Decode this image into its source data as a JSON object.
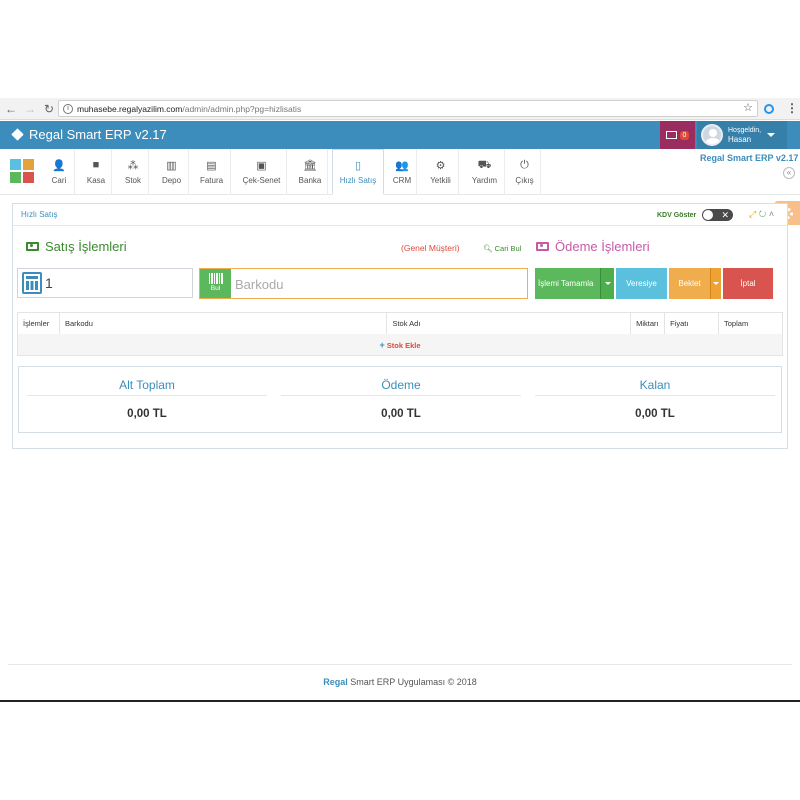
{
  "browser": {
    "url_host": "muhasebe.regalyazilim.com",
    "url_path": "/admin/admin.php?pg=hizlisatis"
  },
  "header": {
    "app_title": "Regal Smart ERP v2.17",
    "notification_count": "0",
    "greeting": "Hoşgeldin,",
    "user_name": "Hasan",
    "colors": {
      "primary": "#3c8dbc",
      "notification_bg": "#9b2c5f"
    }
  },
  "toolbar": {
    "items": [
      {
        "label": "Cari",
        "icon": "user-plus-icon"
      },
      {
        "label": "Kasa",
        "icon": "briefcase-icon"
      },
      {
        "label": "Stok",
        "icon": "cubes-icon"
      },
      {
        "label": "Depo",
        "icon": "building-icon"
      },
      {
        "label": "Fatura",
        "icon": "file-icon"
      },
      {
        "label": "Çek-Senet",
        "icon": "money-icon"
      },
      {
        "label": "Banka",
        "icon": "bank-icon"
      },
      {
        "label": "Hızlı Satış",
        "icon": "mobile-icon",
        "active": true
      },
      {
        "label": "CRM",
        "icon": "users-icon"
      },
      {
        "label": "Yetkili",
        "icon": "cogs-icon"
      },
      {
        "label": "Yardım",
        "icon": "truck-icon"
      },
      {
        "label": "Çıkış",
        "icon": "power-icon"
      }
    ],
    "brand_right": "Regal Smart ERP v2.17"
  },
  "panel": {
    "title": "Hızlı Satış",
    "kdv_label": "KDV Göster"
  },
  "sale": {
    "title": "Satış İşlemleri",
    "customer": "(Genel Müşteri)",
    "find_customer": "Cari Bul",
    "quantity": "1",
    "bul_label": "Bul",
    "barcode_placeholder": "Barkodu"
  },
  "payment": {
    "title": "Ödeme İşlemleri",
    "buttons": {
      "complete": "İşlemi Tamamla",
      "credit": "Veresiye",
      "hold": "Beklet",
      "cancel": "İptal"
    },
    "colors": {
      "success": "#5cb85c",
      "info": "#5bc0de",
      "warning": "#f0ad4e",
      "danger": "#d9534f"
    }
  },
  "table": {
    "columns": [
      "İşlemler",
      "Barkodu",
      "Stok Adı",
      "Miktarı",
      "Fiyatı",
      "Toplam"
    ],
    "add_stock": "Stok Ekle"
  },
  "totals": {
    "subtotal_label": "Alt Toplam",
    "subtotal_value": "0,00 TL",
    "paid_label": "Ödeme",
    "paid_value": "0,00 TL",
    "remaining_label": "Kalan",
    "remaining_value": "0,00 TL"
  },
  "footer": {
    "brand": "Regal",
    "text": "Smart ERP Uygulaması © 2018"
  }
}
